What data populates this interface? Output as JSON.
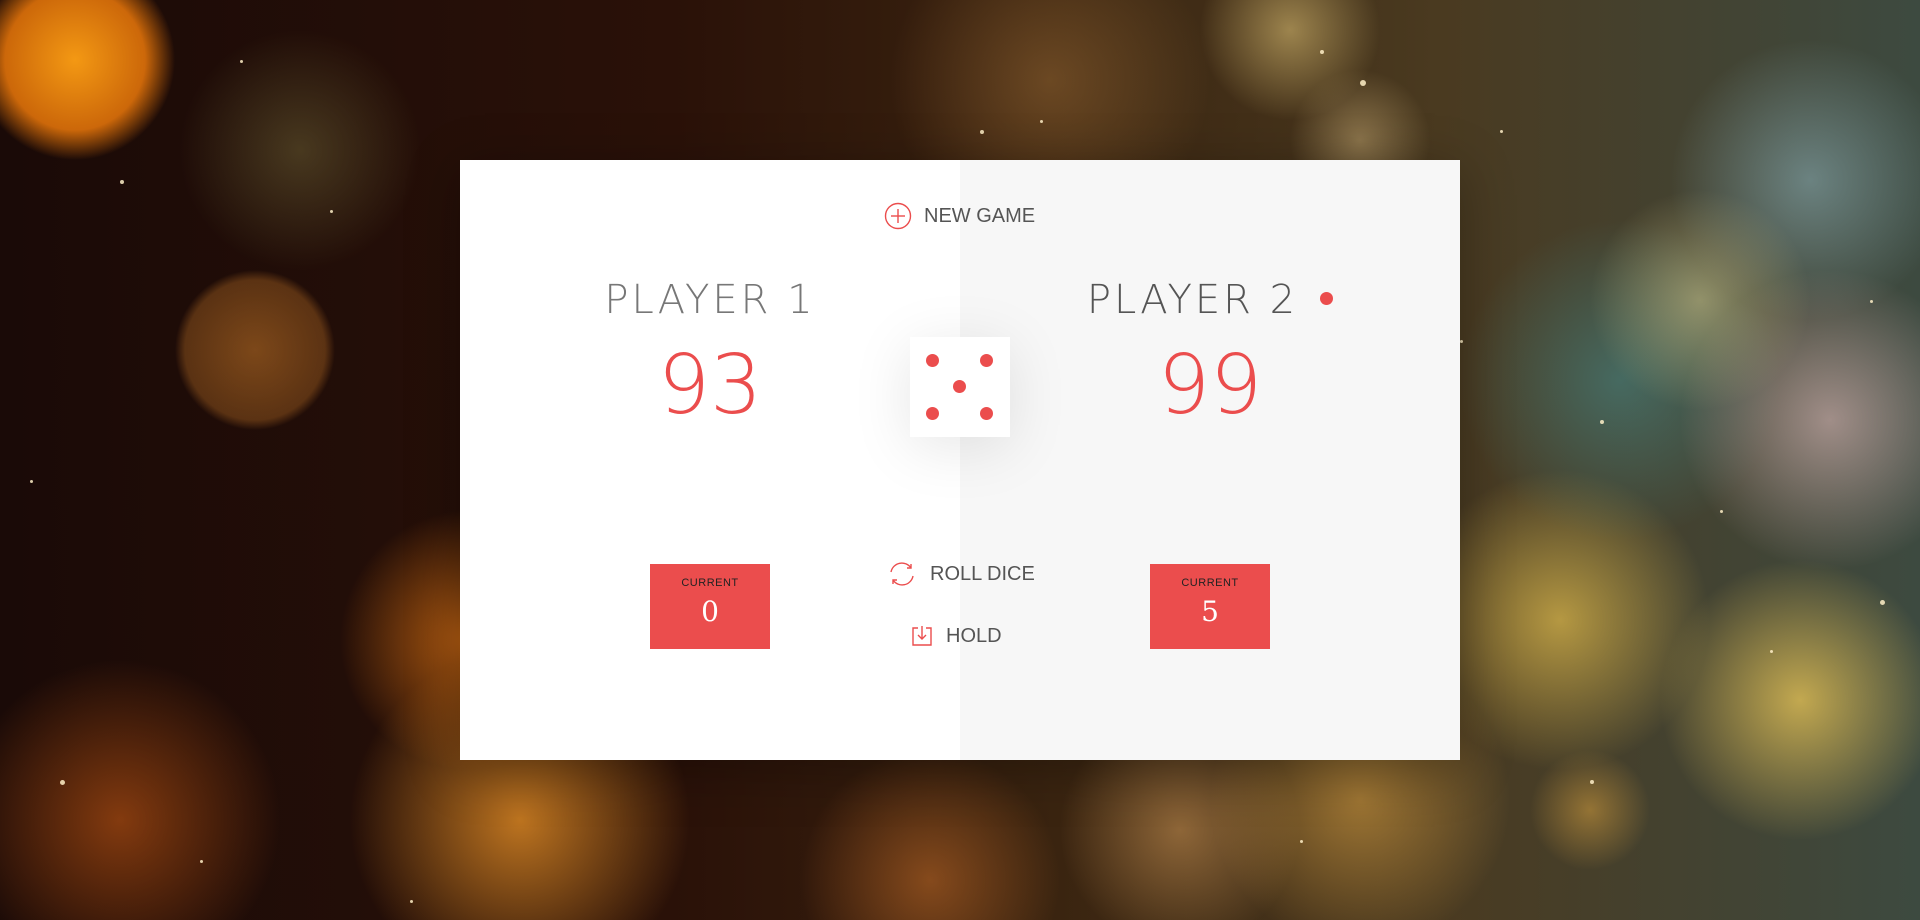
{
  "colors": {
    "accent": "#eb4d4d",
    "panel_left": "#ffffff",
    "panel_right": "#f7f7f7",
    "text": "#555555"
  },
  "controls": {
    "new_game": {
      "label": "NEW GAME",
      "icon": "plus-circle-icon"
    },
    "roll_dice": {
      "label": "ROLL DICE",
      "icon": "refresh-icon"
    },
    "hold": {
      "label": "HOLD",
      "icon": "download-icon"
    }
  },
  "players": [
    {
      "name": "PLAYER 1",
      "score": "93",
      "current_label": "CURRENT",
      "current": "0",
      "active": false
    },
    {
      "name": "PLAYER 2",
      "score": "99",
      "current_label": "CURRENT",
      "current": "5",
      "active": true
    }
  ],
  "dice": {
    "value": 5
  }
}
